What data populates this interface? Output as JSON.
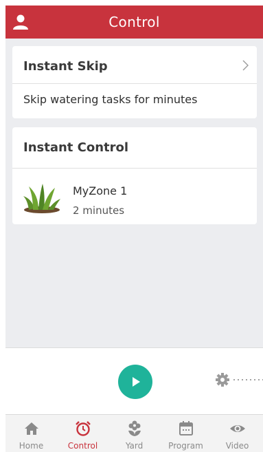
{
  "header": {
    "title": "Control",
    "user_icon": "user-icon"
  },
  "instant_skip": {
    "title": "Instant Skip",
    "description": "Skip watering tasks for minutes"
  },
  "instant_control": {
    "title": "Instant Control",
    "zones": [
      {
        "name": "MyZone 1",
        "duration": "2 minutes",
        "icon": "plant-icon"
      }
    ]
  },
  "player": {
    "play_icon": "play-icon",
    "settings_icon": "gear-icon"
  },
  "tabs": [
    {
      "label": "Home",
      "icon": "home-icon",
      "active": false
    },
    {
      "label": "Control",
      "icon": "alarm-clock-icon",
      "active": true
    },
    {
      "label": "Yard",
      "icon": "flower-icon",
      "active": false
    },
    {
      "label": "Program",
      "icon": "calendar-icon",
      "active": false
    },
    {
      "label": "Video",
      "icon": "eye-icon",
      "active": false
    }
  ],
  "colors": {
    "accent": "#c8333d",
    "play": "#1fb39a",
    "tab_inactive": "#8a8a8a"
  }
}
